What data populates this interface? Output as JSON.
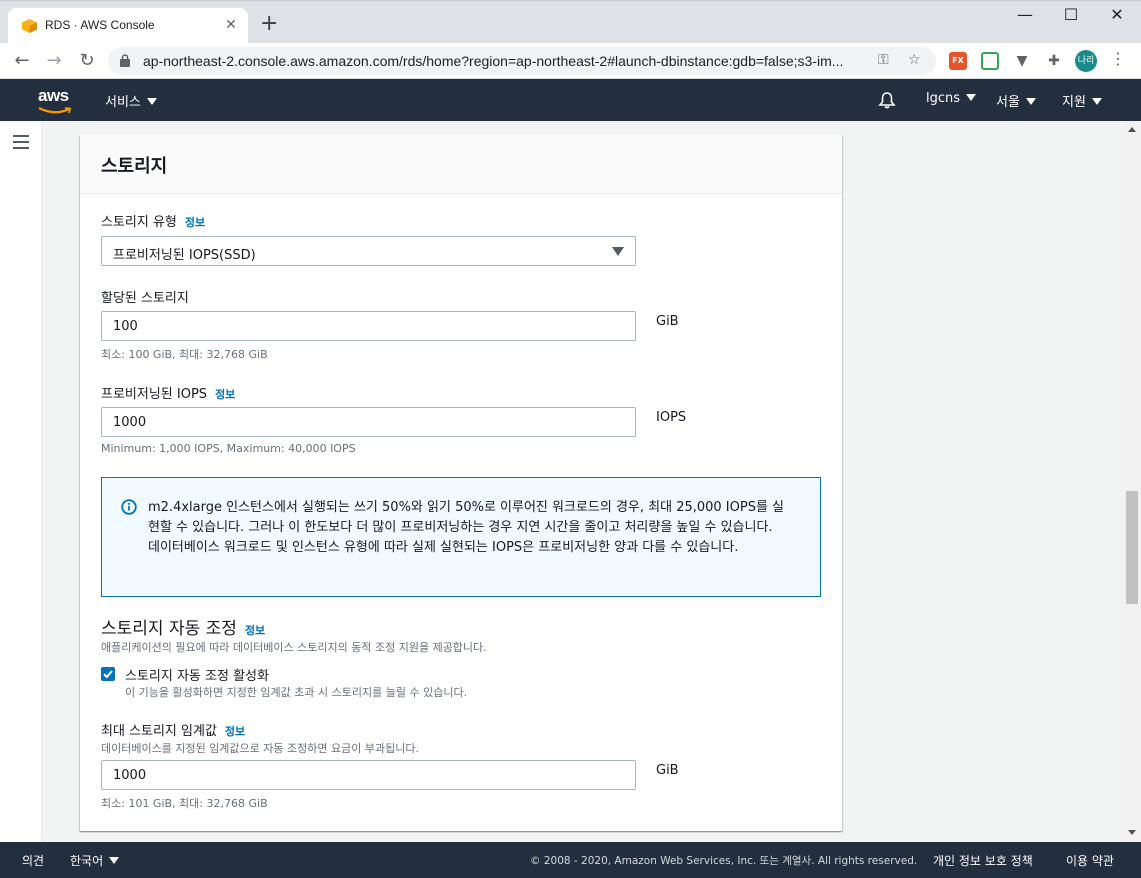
{
  "browser": {
    "tab_title": "RDS · AWS Console",
    "url": "ap-northeast-2.console.aws.amazon.com/rds/home?region=ap-northeast-2#launch-dbinstance:gdb=false;s3-im...",
    "profile_initials": "나리",
    "extension_fx": "FX"
  },
  "aws_nav": {
    "logo": "aws",
    "services": "서비스",
    "account": "lgcns",
    "region": "서울",
    "support": "지원"
  },
  "storage": {
    "title": "스토리지",
    "type_label": "스토리지 유형",
    "info": "정보",
    "type_value": "프로비저닝된 IOPS(SSD)",
    "allocated_label": "할당된 스토리지",
    "allocated_value": "100",
    "allocated_unit": "GiB",
    "allocated_hint": "최소: 100 GiB, 최대: 32,768 GiB",
    "iops_label": "프로비저닝된 IOPS",
    "iops_value": "1000",
    "iops_unit": "IOPS",
    "iops_hint": "Minimum: 1,000 IOPS, Maximum: 40,000 IOPS",
    "alert_text": "m2.4xlarge 인스턴스에서 실행되는 쓰기 50%와 읽기 50%로 이루어진 워크로드의 경우, 최대 25,000 IOPS를 실현할 수 있습니다. 그러나 이 한도보다 더 많이 프로비저닝하는 경우 지연 시간을 줄이고 처리량을 높일 수 있습니다. 데이터베이스 워크로드 및 인스턴스 유형에 따라 실제 실현되는 IOPS은 프로비저닝한 양과 다를 수 있습니다."
  },
  "autoscaling": {
    "title": "스토리지 자동 조정",
    "info": "정보",
    "description": "애플리케이션의 필요에 따라 데이터베이스 스토리지의 동적 조정 지원을 제공합니다.",
    "checkbox_label": "스토리지 자동 조정 활성화",
    "checkbox_checked": true,
    "checkbox_hint": "이 기능을 활성화하면 지정한 임계값 초과 시 스토리지를 늘릴 수 있습니다.",
    "max_label": "최대 스토리지 임계값",
    "max_info": "정보",
    "max_description": "데이터베이스를 지정된 임계값으로 자동 조정하면 요금이 부과됩니다.",
    "max_value": "1000",
    "max_unit": "GiB",
    "max_hint": "최소: 101 GiB, 최대: 32,768 GiB"
  },
  "footer": {
    "feedback": "의견",
    "language": "한국어",
    "copyright": "© 2008 - 2020, Amazon Web Services, Inc. 또는 계열사. All rights reserved.",
    "privacy": "개인 정보 보호 정책",
    "terms": "이용 약관"
  },
  "colors": {
    "aws_nav": "#232f3e",
    "link": "#0073bb",
    "aws_orange": "#ff9900"
  }
}
